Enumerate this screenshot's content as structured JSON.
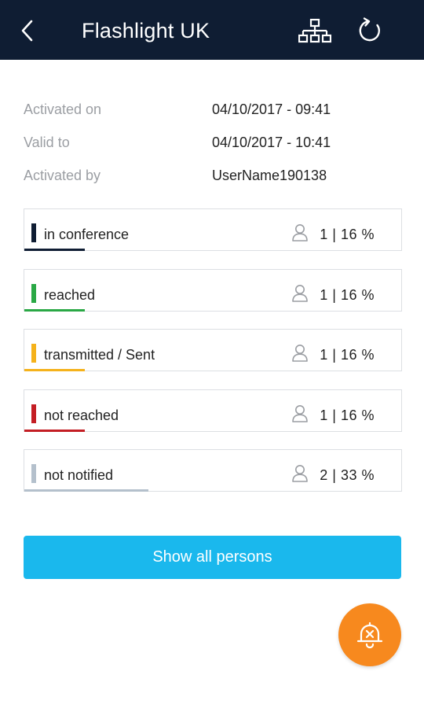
{
  "header": {
    "title": "Flashlight UK",
    "back_icon": "chevron-left-icon",
    "tree_icon": "org-chart-icon",
    "refresh_icon": "refresh-icon",
    "background": "#0f1d33"
  },
  "info": [
    {
      "label": "Activated on",
      "value": "04/10/2017 - 09:41"
    },
    {
      "label": "Valid to",
      "value": "04/10/2017 - 10:41"
    },
    {
      "label": "Activated by",
      "value": "UserName190138"
    }
  ],
  "statuses": [
    {
      "label": "in conference",
      "count": "1 | 16 %",
      "color": "#0f1d33",
      "percent": 16
    },
    {
      "label": "reached",
      "count": "1 | 16 %",
      "color": "#2aa845",
      "percent": 16
    },
    {
      "label": "transmitted / Sent",
      "count": "1 | 16 %",
      "color": "#f5b21b",
      "percent": 16
    },
    {
      "label": "not reached",
      "count": "1 | 16 %",
      "color": "#c41e24",
      "percent": 16
    },
    {
      "label": "not notified",
      "count": "2 | 33 %",
      "color": "#b4c0cc",
      "percent": 33
    }
  ],
  "show_all_label": "Show all persons",
  "fab": {
    "icon": "bell-off-icon",
    "color": "#f7891e"
  }
}
